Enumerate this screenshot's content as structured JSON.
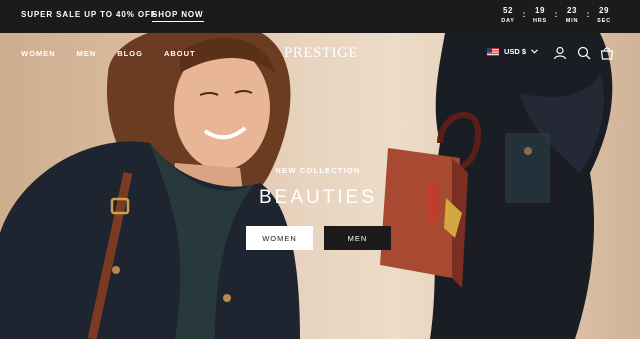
{
  "announcement": {
    "promo_text": "SUPER SALE UP TO 40% OFF",
    "link_label": "SHOP NOW",
    "countdown": [
      {
        "value": "52",
        "label": "DAY"
      },
      {
        "value": "19",
        "label": "HRS"
      },
      {
        "value": "23",
        "label": "MIN"
      },
      {
        "value": "29",
        "label": "SEC"
      }
    ],
    "separator": ":"
  },
  "nav": {
    "links": [
      "WOMEN",
      "MEN",
      "BLOG",
      "ABOUT"
    ],
    "brand": "PRESTIGE",
    "currency": "USD $",
    "icons": [
      "us-flag-icon",
      "chevron-down-icon",
      "user-icon",
      "search-icon",
      "shopping-bag-icon"
    ]
  },
  "hero": {
    "kicker": "NEW COLLECTION",
    "headline": "BEAUTIES",
    "buttons": [
      "WOMEN",
      "MEN"
    ]
  },
  "colors": {
    "bar": "#1b1b1b",
    "text_light": "#ffffff",
    "button_dark": "#1b1b1b",
    "bag": "#a84a32"
  }
}
